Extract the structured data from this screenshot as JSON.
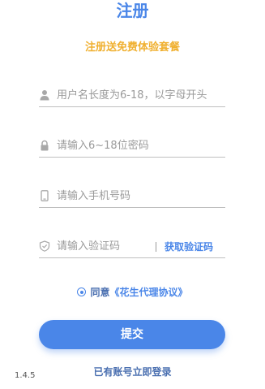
{
  "page": {
    "title": "注册",
    "promo": "注册送免费体验套餐",
    "version": "1.4.5"
  },
  "form": {
    "username": {
      "icon": "user-icon",
      "placeholder": "用户名长度为6-18，以字母开头",
      "value": ""
    },
    "password": {
      "icon": "lock-icon",
      "placeholder": "请输入6~18位密码",
      "value": ""
    },
    "phone": {
      "icon": "phone-icon",
      "placeholder": "请输入手机号码",
      "value": ""
    },
    "code": {
      "icon": "shield-check-icon",
      "placeholder": "请输入验证码",
      "value": "",
      "get_code_label": "获取验证码"
    },
    "agreement": {
      "checked": true,
      "prefix": "同意",
      "link_text": "《花生代理协议》"
    },
    "submit_label": "提交",
    "login_link": "已有账号立即登录"
  },
  "colors": {
    "accent": "#4a86e8",
    "promo": "#f0b030",
    "divider": "#bfbfbf",
    "placeholder": "#9a9a9a"
  }
}
